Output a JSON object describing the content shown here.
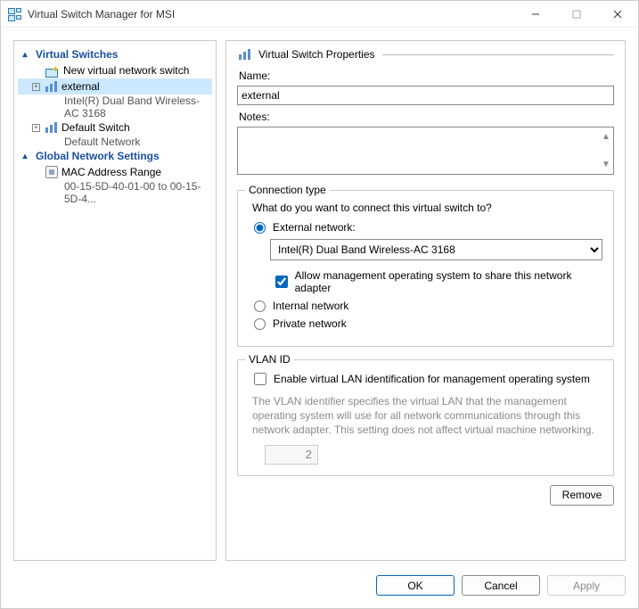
{
  "window": {
    "title": "Virtual Switch Manager for MSI"
  },
  "tree": {
    "section_switches": "Virtual Switches",
    "new_switch": "New virtual network switch",
    "items": [
      {
        "name": "external",
        "detail": "Intel(R) Dual Band Wireless-AC 3168"
      },
      {
        "name": "Default Switch",
        "detail": "Default Network"
      }
    ],
    "section_global": "Global Network Settings",
    "mac": {
      "label": "MAC Address Range",
      "detail": "00-15-5D-40-01-00 to 00-15-5D-4..."
    }
  },
  "props": {
    "header": "Virtual Switch Properties",
    "name_label": "Name:",
    "name_value": "external",
    "notes_label": "Notes:",
    "notes_value": ""
  },
  "conn": {
    "group": "Connection type",
    "question": "What do you want to connect this virtual switch to?",
    "external_label": "External network:",
    "adapter": "Intel(R) Dual Band Wireless-AC 3168",
    "allow_mgmt": "Allow management operating system to share this network adapter",
    "internal_label": "Internal network",
    "private_label": "Private network"
  },
  "vlan": {
    "group": "VLAN ID",
    "enable": "Enable virtual LAN identification for management operating system",
    "help": "The VLAN identifier specifies the virtual LAN that the management operating system will use for all network communications through this network adapter. This setting does not affect virtual machine networking.",
    "value": "2"
  },
  "buttons": {
    "remove": "Remove",
    "ok": "OK",
    "cancel": "Cancel",
    "apply": "Apply"
  }
}
